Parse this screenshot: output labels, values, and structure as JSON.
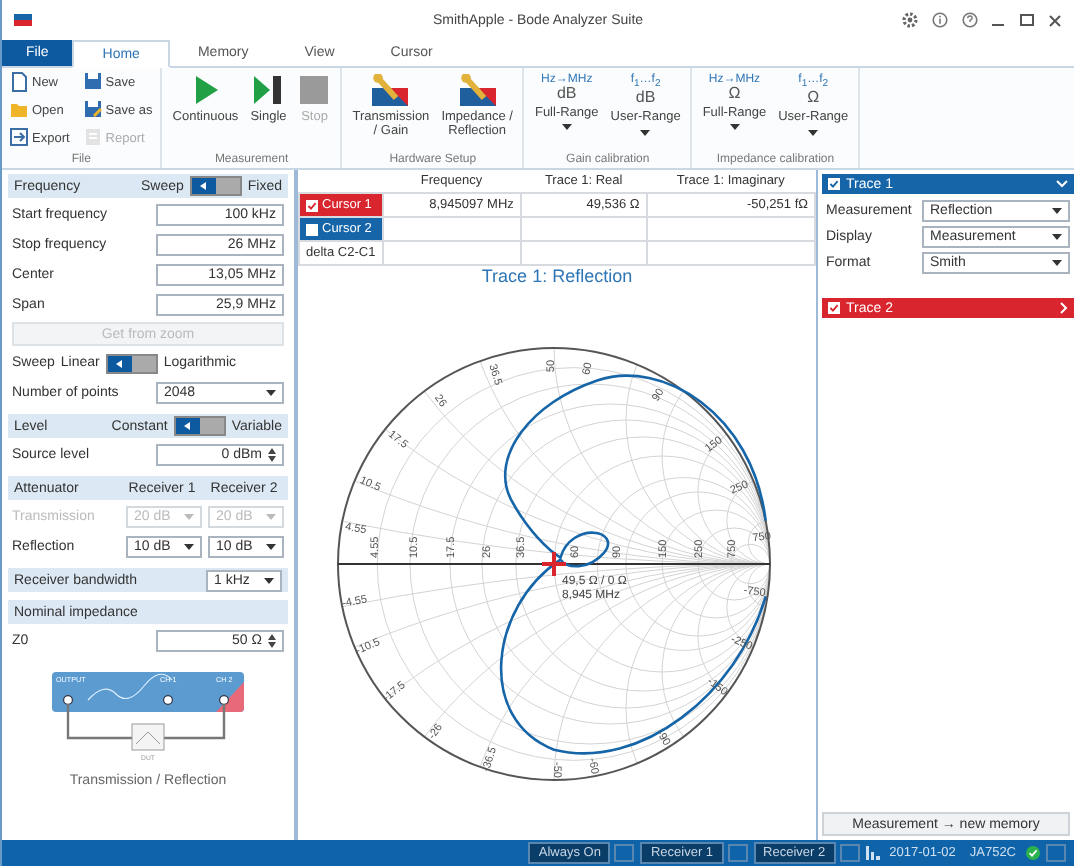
{
  "window": {
    "title": "SmithApple - Bode Analyzer Suite"
  },
  "tabs": [
    {
      "label": "File",
      "kind": "file",
      "selected": false
    },
    {
      "label": "Home",
      "kind": "tab",
      "selected": true
    },
    {
      "label": "Memory",
      "kind": "tab",
      "selected": false
    },
    {
      "label": "View",
      "kind": "tab",
      "selected": false
    },
    {
      "label": "Cursor",
      "kind": "tab",
      "selected": false
    }
  ],
  "ribbon": [
    {
      "caption": "File",
      "kind": "small",
      "items": [
        {
          "label": "New",
          "disabled": false
        },
        {
          "label": "Save",
          "disabled": false
        },
        {
          "label": "Open",
          "disabled": false
        },
        {
          "label": "Save as",
          "disabled": false
        },
        {
          "label": "Export",
          "disabled": false
        },
        {
          "label": "Report",
          "disabled": true
        }
      ]
    },
    {
      "caption": "Measurement",
      "kind": "large",
      "items": [
        {
          "label": "Continuous",
          "disabled": false
        },
        {
          "label": "Single",
          "disabled": false
        },
        {
          "label": "Stop",
          "disabled": true
        }
      ]
    },
    {
      "caption": "Hardware Setup",
      "kind": "large",
      "items": [
        {
          "label": "Transmission\n/ Gain",
          "disabled": false
        },
        {
          "label": "Impedance /\nReflection",
          "disabled": false
        }
      ]
    },
    {
      "caption": "Gain calibration",
      "kind": "calibration",
      "items": [
        {
          "label": "Full-Range",
          "top": "Hz→MHz",
          "unit": "dB",
          "disabled": false
        },
        {
          "label": "User-Range",
          "top": "f$_{1}$…f$_{2}$",
          "unit": "dB",
          "disabled": false
        }
      ]
    },
    {
      "caption": "Impedance calibration",
      "kind": "calibration",
      "items": [
        {
          "label": "Full-Range",
          "top": "Hz→MHz",
          "unit": "Ω",
          "disabled": false
        },
        {
          "label": "User-Range",
          "top": "f$_{1}$…f$_{2}$",
          "unit": "Ω",
          "disabled": false
        }
      ]
    }
  ],
  "left_panel": {
    "sections": [
      {
        "header": {
          "kind": "toggle",
          "title": "Frequency",
          "left": "Sweep",
          "right": "Fixed",
          "right_selected": false
        },
        "rows": [
          {
            "kind": "field",
            "label": "Start frequency",
            "value": "100 kHz"
          },
          {
            "kind": "field",
            "label": "Stop frequency",
            "value": "26 MHz"
          },
          {
            "kind": "field",
            "label": "Center",
            "value": "13,05 MHz"
          },
          {
            "kind": "field",
            "label": "Span",
            "value": "25,9 MHz"
          },
          {
            "kind": "button",
            "label": "Get from zoom",
            "disabled": true
          },
          {
            "kind": "toggle",
            "label": "Sweep",
            "left": "Linear",
            "right": "Logarithmic",
            "right_selected": false
          },
          {
            "kind": "dropdown",
            "label": "Number of points",
            "value": "2048"
          }
        ]
      },
      {
        "header": {
          "kind": "toggle",
          "title": "Level",
          "left": "Constant",
          "right": "Variable",
          "right_selected": false
        },
        "rows": [
          {
            "kind": "spinner",
            "label": "Source level",
            "value": "0 dBm"
          }
        ]
      },
      {
        "header": {
          "kind": "columns",
          "title": "Attenuator",
          "columns": [
            "Receiver 1",
            "Receiver 2"
          ]
        },
        "rows": [
          {
            "kind": "pair",
            "label": "Transmission",
            "values": [
              "20 dB",
              "20 dB"
            ],
            "disabled": true
          },
          {
            "kind": "pair",
            "label": "Reflection",
            "values": [
              "10 dB",
              "10 dB"
            ],
            "disabled": false
          }
        ]
      },
      {
        "header": {
          "kind": "dropdown",
          "title": "Receiver bandwidth",
          "value": "1 kHz"
        }
      },
      {
        "header": {
          "kind": "plain",
          "title": "Nominal impedance"
        },
        "rows": [
          {
            "kind": "spinner",
            "label": "Z0",
            "value": "50 Ω"
          }
        ]
      }
    ],
    "diagram": {
      "output": "OUTPUT",
      "ch1": "CH 1",
      "ch2": "CH 2",
      "dut": "DUT",
      "caption": "Transmission / Reflection"
    }
  },
  "cursor_table": {
    "columns": [
      "Frequency",
      "Trace 1: Real",
      "Trace 1: Imaginary"
    ],
    "rows": [
      {
        "kind": "cursor",
        "label": "Cursor 1",
        "color": "#d9252e",
        "checked": true,
        "cells": [
          "8,945097 MHz",
          "49,536 Ω",
          "-50,251 fΩ"
        ]
      },
      {
        "kind": "cursor",
        "label": "Cursor 2",
        "color": "#1565a8",
        "checked": false
      },
      {
        "kind": "delta",
        "label": "delta C2-C1"
      }
    ]
  },
  "smith_chart": {
    "title": "Trace 1: Reflection",
    "upper_labels": [
      "4.55",
      "10.5",
      "17.5",
      "26",
      "36.5",
      "50",
      "60",
      "90",
      "150",
      "250",
      "750"
    ],
    "axis_labels": [
      "4.55",
      "10.5",
      "17.5",
      "26",
      "36.5",
      "60",
      "90",
      "150",
      "250",
      "750"
    ],
    "lower_labels": [
      "-4.55",
      "-10.5",
      "-17.5",
      "-26",
      "-36.5",
      "-50",
      "-60",
      "-90",
      "-150",
      "-250",
      "-750"
    ],
    "marker_readout": [
      "49,5 Ω / 0 Ω",
      "8,945 MHz"
    ]
  },
  "traces": [
    {
      "name": "Trace 1",
      "color": "#1565a8",
      "checked": true,
      "expanded": true,
      "rows": [
        {
          "label": "Measurement",
          "value": "Reflection"
        },
        {
          "label": "Display",
          "value": "Measurement"
        },
        {
          "label": "Format",
          "value": "Smith"
        }
      ]
    },
    {
      "name": "Trace 2",
      "color": "#d9252e",
      "checked": true,
      "expanded": false
    }
  ],
  "memory_button": "Measurement → new memory",
  "status_bar": [
    {
      "kind": "indicator",
      "label": "Always On"
    },
    {
      "kind": "indicator",
      "label": "Receiver 1"
    },
    {
      "kind": "indicator",
      "label": "Receiver 2"
    },
    {
      "kind": "text",
      "label": "2017-01-02"
    },
    {
      "kind": "text",
      "label": "JA752C"
    }
  ]
}
